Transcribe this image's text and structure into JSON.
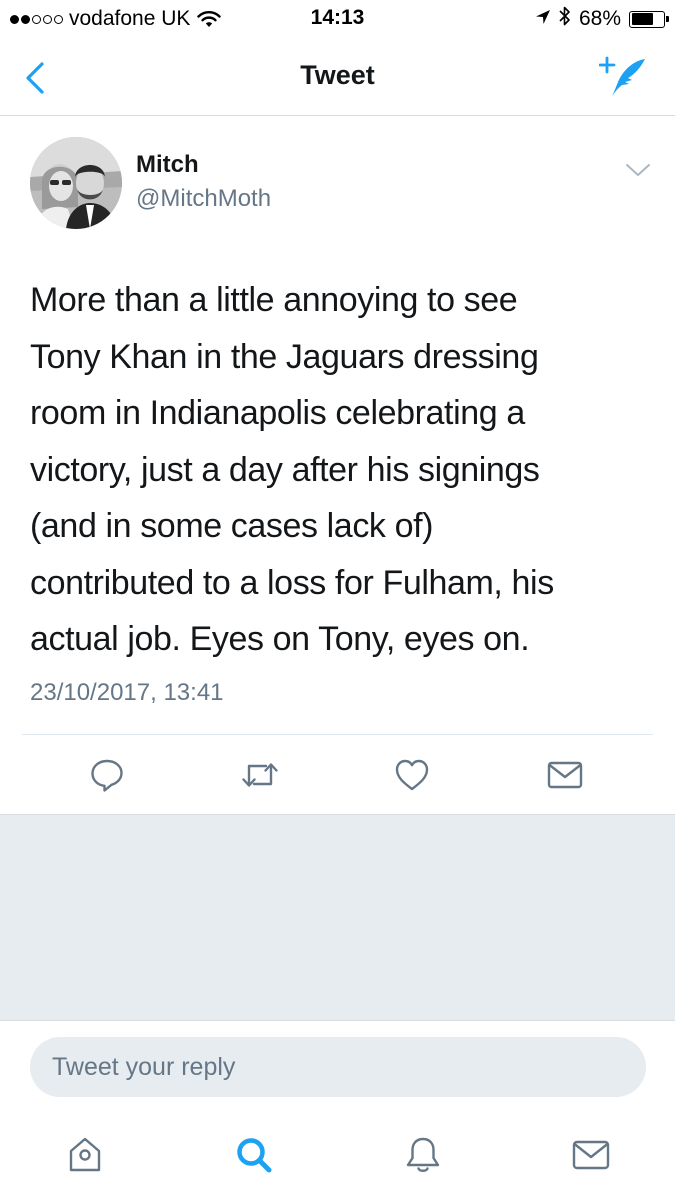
{
  "status_bar": {
    "carrier": "vodafone UK",
    "signal_bars": 1,
    "time": "14:13",
    "battery_percent": "68%",
    "battery_level": 0.68,
    "icons": [
      "wifi-icon",
      "location-arrow-icon",
      "bluetooth-icon",
      "battery-icon"
    ]
  },
  "nav": {
    "title": "Tweet",
    "back_icon": "chevron-left-icon",
    "compose_icon": "compose-tweet-icon",
    "accent_color": "#1da1f2"
  },
  "tweet": {
    "author_name": "Mitch",
    "author_handle": "@MitchMoth",
    "text_lines": [
      "More than a little annoying to see",
      "Tony Khan in the Jaguars dressing",
      "room in Indianapolis celebrating a",
      "victory, just a day after his signings",
      "(and in some cases lack of)",
      "contributed to a loss for Fulham, his",
      "actual job. Eyes on Tony, eyes on."
    ],
    "timestamp": "23/10/2017, 13:41",
    "actions": [
      "reply-icon",
      "retweet-icon",
      "like-icon",
      "direct-message-icon"
    ]
  },
  "reply": {
    "placeholder": "Tweet your reply"
  },
  "tab_bar": {
    "tabs": [
      "home-icon",
      "search-icon",
      "notifications-icon",
      "messages-icon"
    ],
    "active_tab": "search-icon"
  },
  "colors": {
    "accent": "#1da1f2",
    "secondary_text": "#657786",
    "background_grey": "#e6ecf0"
  }
}
